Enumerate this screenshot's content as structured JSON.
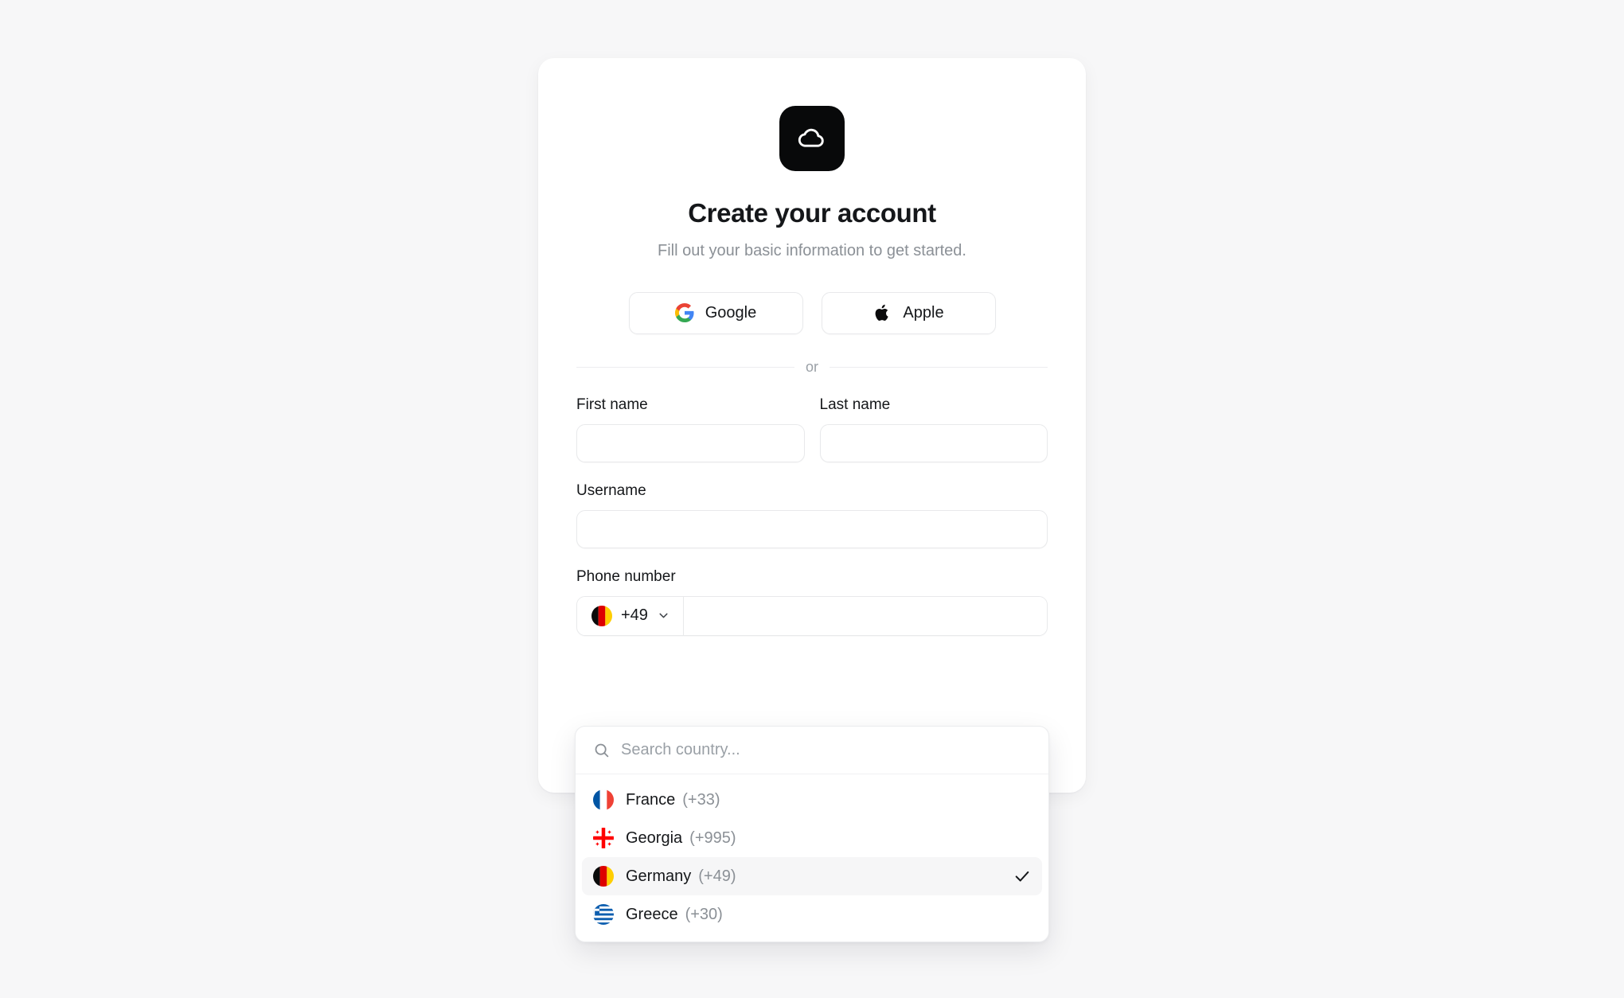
{
  "brand": {
    "logo_icon": "cloud-icon",
    "logo_bg": "#08090a"
  },
  "header": {
    "title": "Create your account",
    "subtitle": "Fill out your basic information to get started."
  },
  "social": {
    "google": {
      "label": "Google",
      "icon": "google-icon"
    },
    "apple": {
      "label": "Apple",
      "icon": "apple-icon"
    }
  },
  "divider": {
    "label": "or"
  },
  "form": {
    "first_name": {
      "label": "First name",
      "value": "",
      "placeholder": ""
    },
    "last_name": {
      "label": "Last name",
      "value": "",
      "placeholder": ""
    },
    "username": {
      "label": "Username",
      "value": "",
      "placeholder": ""
    },
    "phone": {
      "label": "Phone number",
      "selected_dial_code": "+49",
      "selected_country": "Germany",
      "selected_flag": "flag-de",
      "value": "",
      "placeholder": ""
    }
  },
  "country_dropdown": {
    "open": true,
    "search": {
      "placeholder": "Search country...",
      "value": "",
      "icon": "search-icon"
    },
    "check_icon": "check-icon",
    "options": [
      {
        "name": "France",
        "code": "(+33)",
        "flag": "flag-fr",
        "selected": false
      },
      {
        "name": "Georgia",
        "code": "(+995)",
        "flag": "flag-ge",
        "selected": false
      },
      {
        "name": "Germany",
        "code": "(+49)",
        "flag": "flag-de",
        "selected": true
      },
      {
        "name": "Greece",
        "code": "(+30)",
        "flag": "flag-gr",
        "selected": false
      }
    ]
  },
  "colors": {
    "page_bg": "#f7f7f8",
    "card_bg": "#ffffff",
    "text_primary": "#15171a",
    "text_muted": "#8b9096",
    "border": "#e8e9eb",
    "selected_row_bg": "#f6f6f7"
  }
}
